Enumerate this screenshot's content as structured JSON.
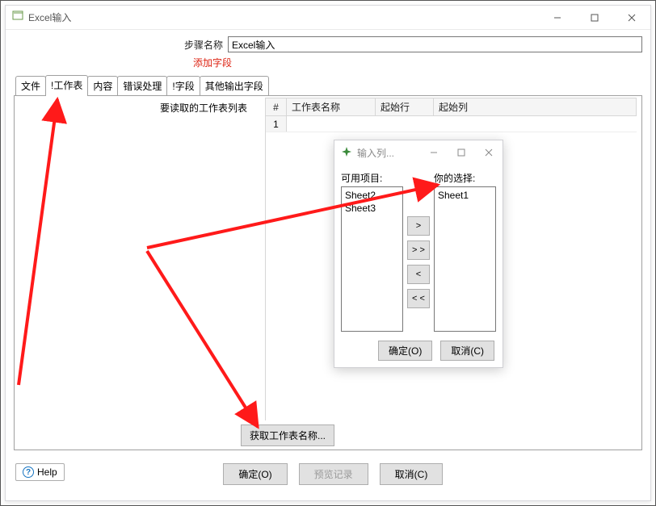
{
  "window": {
    "title": "Excel输入"
  },
  "form": {
    "step_label": "步骤名称",
    "step_value": "Excel输入",
    "add_field": "添加字段"
  },
  "tabs": [
    "文件",
    "!工作表",
    "内容",
    "错误处理",
    "!字段",
    "其他输出字段"
  ],
  "active_tab_index": 1,
  "sheets": {
    "label": "要读取的工作表列表",
    "columns": {
      "num": "#",
      "name": "工作表名称",
      "start_row": "起始行",
      "start_col": "起始列"
    },
    "rows": [
      {
        "num": "1",
        "name": "",
        "start_row": "",
        "start_col": ""
      }
    ],
    "get_sheets_btn": "获取工作表名称..."
  },
  "bottom": {
    "help": "Help",
    "ok": "确定(O)",
    "preview": "预览记录",
    "cancel": "取消(C)"
  },
  "inner_dialog": {
    "title": "输入列...",
    "available_label": "可用项目:",
    "selected_label": "你的选择:",
    "available": [
      "Sheet2",
      "Sheet3"
    ],
    "selected": [
      "Sheet1"
    ],
    "btn_add": ">",
    "btn_add_all": "> >",
    "btn_remove": "<",
    "btn_remove_all": "< <",
    "ok": "确定(O)",
    "cancel": "取消(C)"
  }
}
